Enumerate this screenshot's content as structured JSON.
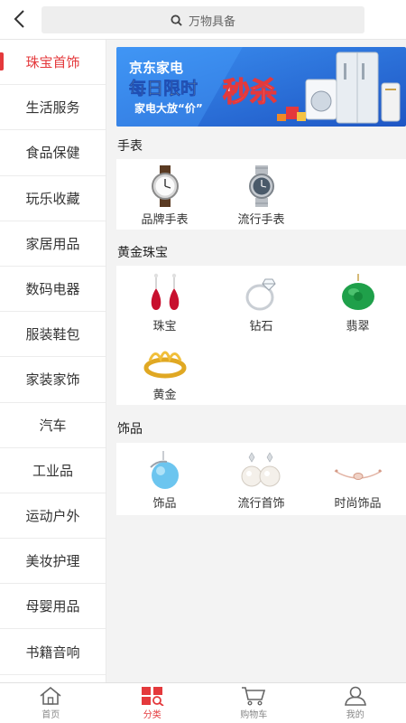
{
  "header": {
    "search_placeholder": "万物具备"
  },
  "sidebar": {
    "items": [
      {
        "label": "珠宝首饰",
        "active": true
      },
      {
        "label": "生活服务"
      },
      {
        "label": "食品保健"
      },
      {
        "label": "玩乐收藏"
      },
      {
        "label": "家居用品"
      },
      {
        "label": "数码电器"
      },
      {
        "label": "服装鞋包"
      },
      {
        "label": "家装家饰"
      },
      {
        "label": "汽车"
      },
      {
        "label": "工业品"
      },
      {
        "label": "运动户外"
      },
      {
        "label": "美妆护理"
      },
      {
        "label": "母婴用品"
      },
      {
        "label": "书籍音响"
      }
    ]
  },
  "banner": {
    "brand": "京东家电",
    "headline": "每日限时",
    "big": "秒杀",
    "sub": "家电大放“价”"
  },
  "sections": [
    {
      "title": "手表",
      "items": [
        {
          "label": "品牌手表",
          "icon": "brand-watch-icon"
        },
        {
          "label": "流行手表",
          "icon": "fashion-watch-icon"
        }
      ]
    },
    {
      "title": "黄金珠宝",
      "items": [
        {
          "label": "珠宝",
          "icon": "earring-icon"
        },
        {
          "label": "钻石",
          "icon": "diamond-ring-icon"
        },
        {
          "label": "翡翠",
          "icon": "jade-icon"
        },
        {
          "label": "黄金",
          "icon": "gold-ring-icon"
        }
      ]
    },
    {
      "title": "饰品",
      "items": [
        {
          "label": "饰品",
          "icon": "pendant-icon"
        },
        {
          "label": "流行首饰",
          "icon": "pearl-earring-icon"
        },
        {
          "label": "时尚饰品",
          "icon": "bracelet-icon"
        }
      ]
    }
  ],
  "tabbar": {
    "items": [
      {
        "label": "首页",
        "icon": "home-icon"
      },
      {
        "label": "分类",
        "icon": "category-icon",
        "active": true
      },
      {
        "label": "购物车",
        "icon": "cart-icon"
      },
      {
        "label": "我的",
        "icon": "user-icon"
      }
    ]
  },
  "colors": {
    "accent": "#e4393c",
    "banner_bg": "#2a6fd6"
  }
}
